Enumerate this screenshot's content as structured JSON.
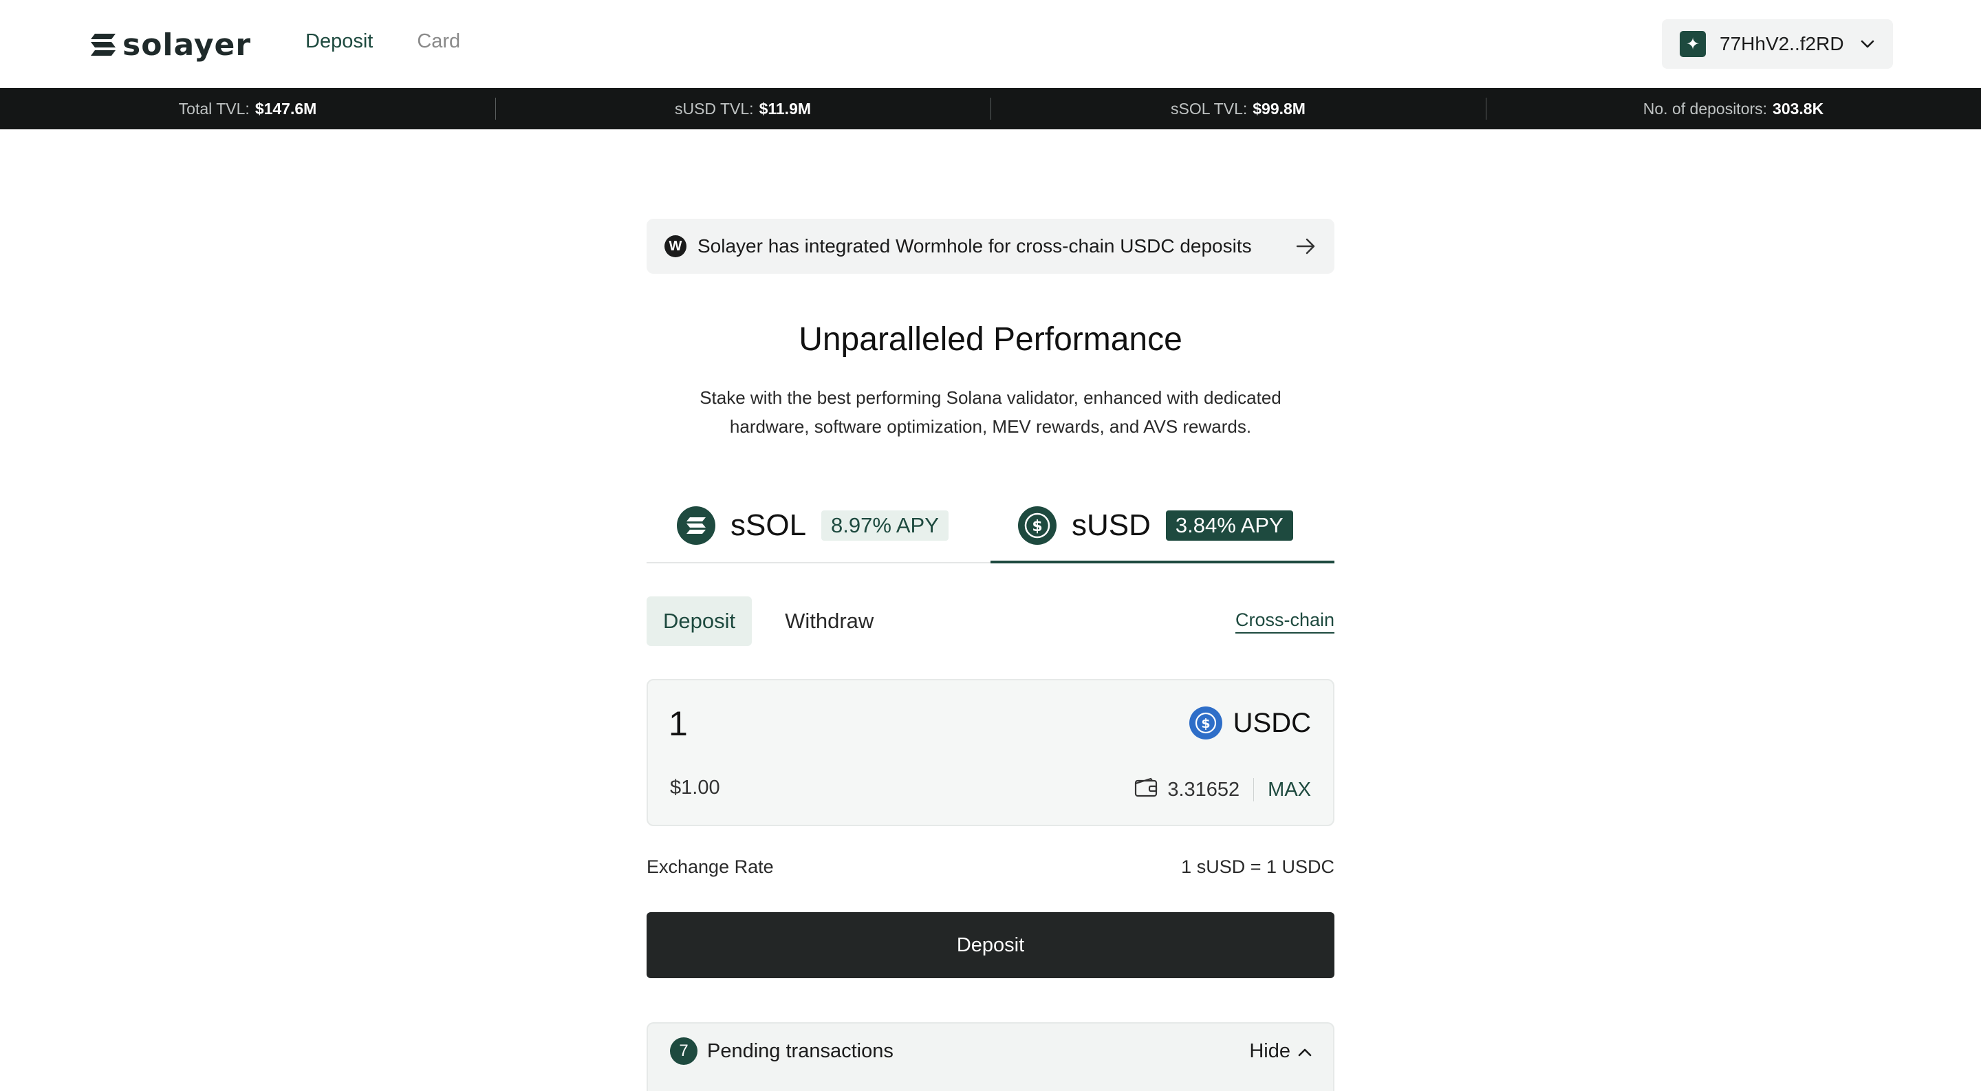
{
  "header": {
    "logo_text": "solayer",
    "nav": [
      {
        "label": "Deposit",
        "active": true
      },
      {
        "label": "Card",
        "active": false
      }
    ],
    "wallet": {
      "avatar_glyph": "✦",
      "address": "77HhV2..f2RD",
      "icon": "chevron-down-icon"
    }
  },
  "stats": [
    {
      "label": "Total TVL:",
      "value": "$147.6M"
    },
    {
      "label": "sUSD TVL:",
      "value": "$11.9M"
    },
    {
      "label": "sSOL TVL:",
      "value": "$99.8M"
    },
    {
      "label": "No. of depositors:",
      "value": "303.8K"
    }
  ],
  "banner": {
    "logo_glyph": "W",
    "text": "Solayer has integrated Wormhole for cross-chain USDC deposits",
    "icon": "arrow-right-icon"
  },
  "hero": {
    "title": "Unparalleled Performance",
    "subtitle": "Stake with the best performing Solana validator, enhanced with dedicated hardware, software optimization, MEV rewards, and AVS rewards."
  },
  "asset_tabs": [
    {
      "name": "sSOL",
      "apy": "8.97% APY",
      "active": false,
      "icon": "ssol-icon"
    },
    {
      "name": "sUSD",
      "apy": "3.84% APY",
      "active": true,
      "icon": "susd-icon"
    }
  ],
  "actions": {
    "deposit_label": "Deposit",
    "withdraw_label": "Withdraw",
    "cross_chain_label": "Cross-chain"
  },
  "input": {
    "amount": "1",
    "token": "USDC",
    "usd_value": "$1.00",
    "balance": "3.31652",
    "max_label": "MAX",
    "icons": [
      "usdc-icon",
      "wallet-icon"
    ]
  },
  "rate": {
    "label": "Exchange Rate",
    "value": "1 sUSD = 1 USDC"
  },
  "deposit_button": "Deposit",
  "pending": {
    "count": "7",
    "label": "Pending transactions",
    "hide_label": "Hide",
    "icon": "chevron-up-icon"
  },
  "colors": {
    "accent": "#1e4a3f",
    "stats_bg": "#141616",
    "button_bg": "#232626",
    "usdc": "#2e6ec8"
  }
}
